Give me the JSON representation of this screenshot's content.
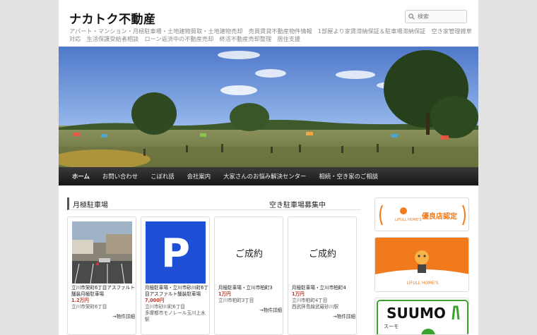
{
  "site": {
    "title": "ナカトク不動産",
    "tagline": "アパート・マンション・月極駐車場・土地建物買取・土地建物売却　売買賃貸不動産物件情報　1部屋より家賃滞納保証＆駐車場滞納保証　空き家管理雑草対応　生活保護受給者相談　ローン返済中の不動産売却　終活不動産売却整理　居住支援"
  },
  "search": {
    "placeholder": "検索",
    "icon": "search-icon"
  },
  "nav": {
    "items": [
      "ホーム",
      "お問い合わせ",
      "こぼれ話",
      "会社案内",
      "大家さんのお悩み解決センター",
      "相続・空き家のご相談"
    ],
    "active_index": 0
  },
  "section": {
    "left_title": "月極駐車場",
    "right_title": "空き駐車場募集中"
  },
  "cards": [
    {
      "image": "parking-lot-photo",
      "title": "立川市栄町6丁目アスファルト舗装月極駐車場",
      "price": "1.2万円",
      "location": "立川市栄町6丁目",
      "detail": "→物件詳細"
    },
    {
      "image": "parking-sign",
      "sign_letter": "P",
      "title": "月極駐車場・立川市砂川町6丁目アスファルト舗装駐車場",
      "price": "7,000円",
      "location": "立川市砂川町6丁目\n多摩都市モノレール玉川上水駅",
      "detail": "→物件詳細"
    },
    {
      "image": "placeholder",
      "placeholder_text": "ご成約",
      "title": "月極駐車場・立川市柏町3",
      "price": "1万円",
      "location": "立川市柏町3丁目",
      "detail": "→物件詳細"
    },
    {
      "image": "placeholder",
      "placeholder_text": "ご成約",
      "title": "月極駐車場・立川市柏町4",
      "price": "1万円",
      "location": "立川市柏町4丁目\n西武拝島線武蔵砂川駅",
      "detail": "→物件詳細"
    }
  ],
  "sidebar": {
    "badge1": {
      "brand": "LIFULL HOME'S",
      "label": "優良店認定"
    },
    "badge2": {
      "brand": "LIFULL HOME'S"
    },
    "badge3": {
      "brand": "SUUMO",
      "sub": "スーモ"
    }
  },
  "colors": {
    "nav_bg": "#222222",
    "price": "#c0392b",
    "homes_orange": "#f07a1c",
    "suumo_green": "#3aa32d"
  }
}
